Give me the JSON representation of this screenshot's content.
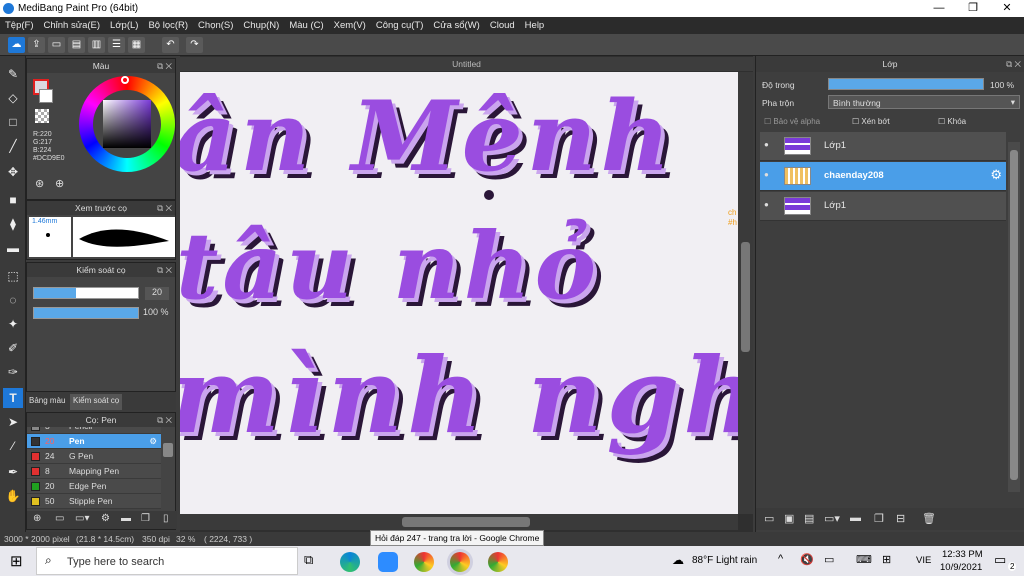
{
  "window": {
    "title": "MediBang Paint Pro (64bit)",
    "controls": [
      "—",
      "❐",
      "✕"
    ]
  },
  "menu": [
    "Tệp(F)",
    "Chỉnh sửa(E)",
    "Lớp(L)",
    "Bộ lọc(R)",
    "Chọn(S)",
    "Chụp(N)",
    "Màu (C)",
    "Xem(V)",
    "Công cụ(T)",
    "Cửa sổ(W)",
    "Cloud",
    "Help"
  ],
  "color_panel": {
    "title": "Màu",
    "r": "R:220",
    "g": "G:217",
    "b": "B:224",
    "hex": "#DCD9E0"
  },
  "brush_preview": {
    "title": "Xem trước cọ",
    "size": "1.46mm"
  },
  "brush_control": {
    "title": "Kiểm soát cọ",
    "size_value": "20",
    "opacity_value": "100 %"
  },
  "palette_tabs": [
    "Bảng màu",
    "Kiểm soát cọ"
  ],
  "brush_panel": {
    "title": "Cọ: Pen",
    "items": [
      {
        "size": "3",
        "name": "Pencil",
        "color": "#888888"
      },
      {
        "size": "20",
        "name": "Pen",
        "color": "#333333",
        "selected": true
      },
      {
        "size": "24",
        "name": "G Pen",
        "color": "#e03030"
      },
      {
        "size": "8",
        "name": "Mapping Pen",
        "color": "#e03030"
      },
      {
        "size": "20",
        "name": "Edge Pen",
        "color": "#20a020"
      },
      {
        "size": "50",
        "name": "Stipple Pen",
        "color": "#e0c020"
      }
    ]
  },
  "document": {
    "tab": "Untitled",
    "lines": [
      "ân Mênh",
      "tâu nhỏ",
      "mình nghĩ"
    ],
    "side_note": [
      "ch",
      "#h"
    ]
  },
  "layer_panel": {
    "title": "Lớp",
    "opacity_label": "Độ trong",
    "opacity_value": "100 %",
    "blend_label": "Pha trộn",
    "blend_value": "Bình thường",
    "protect_alpha": "Bảo vệ alpha",
    "clipping": "Xén bớt",
    "lock": "Khóa",
    "layers": [
      {
        "name": "Lớp1",
        "selected": false
      },
      {
        "name": "chaenday208",
        "selected": true
      },
      {
        "name": "Lớp1",
        "selected": false
      }
    ]
  },
  "status": {
    "size": "3000 * 2000 pixel",
    "dims": "(21.8 * 14.5cm)",
    "dpi": "350 dpi",
    "zoom": "32 %",
    "coords": "( 2224, 733 )"
  },
  "tooltip": "Hỏi đáp 247 - trang tra lời - Google Chrome",
  "taskbar": {
    "search_placeholder": "Type here to search",
    "weather": "88°F  Light rain",
    "lang": "VIE",
    "time": "12:33 PM",
    "date": "10/9/2021",
    "notif_count": "2"
  }
}
